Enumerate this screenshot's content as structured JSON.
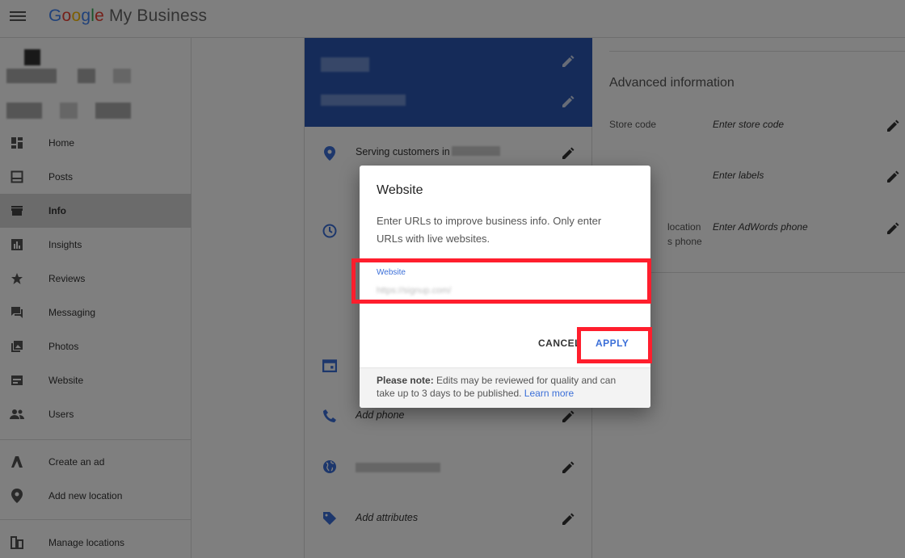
{
  "app": {
    "brand_google": "Google",
    "brand_product": "My Business"
  },
  "sidebar": {
    "items": [
      {
        "label": "Home",
        "icon": "dashboard-icon"
      },
      {
        "label": "Posts",
        "icon": "posts-icon"
      },
      {
        "label": "Info",
        "icon": "store-icon",
        "active": true
      },
      {
        "label": "Insights",
        "icon": "insights-icon"
      },
      {
        "label": "Reviews",
        "icon": "star-icon"
      },
      {
        "label": "Messaging",
        "icon": "chat-icon"
      },
      {
        "label": "Photos",
        "icon": "photos-icon"
      },
      {
        "label": "Website",
        "icon": "website-icon"
      },
      {
        "label": "Users",
        "icon": "users-icon"
      }
    ],
    "secondary": [
      {
        "label": "Create an ad",
        "icon": "ads-icon"
      },
      {
        "label": "Add new location",
        "icon": "location-pin-icon"
      }
    ],
    "bottom": [
      {
        "label": "Manage locations",
        "icon": "locations-icon"
      }
    ]
  },
  "info_card": {
    "serving_label": "Serving customers in",
    "add_phone": "Add phone",
    "add_attributes": "Add attributes"
  },
  "advanced": {
    "title": "Advanced information",
    "store_code_label": "Store code",
    "store_code_value": "Enter store code",
    "labels_value": "Enter labels",
    "adwords_label_line1": "location",
    "adwords_label_line2": "s phone",
    "adwords_value": "Enter AdWords phone"
  },
  "dialog": {
    "title": "Website",
    "description": "Enter URLs to improve business info. Only enter URLs with live websites.",
    "field_label": "Website",
    "field_value": "https://signup.com/",
    "cancel": "CANCEL",
    "apply": "APPLY",
    "note_bold": "Please note:",
    "note_text": " Edits may be reviewed for quality and can take up to 3 days to be published. ",
    "note_link": "Learn more"
  },
  "colors": {
    "header_blue": "#2b57b3",
    "link_blue": "#3b6fd8",
    "highlight_red": "#ff1e2d"
  }
}
